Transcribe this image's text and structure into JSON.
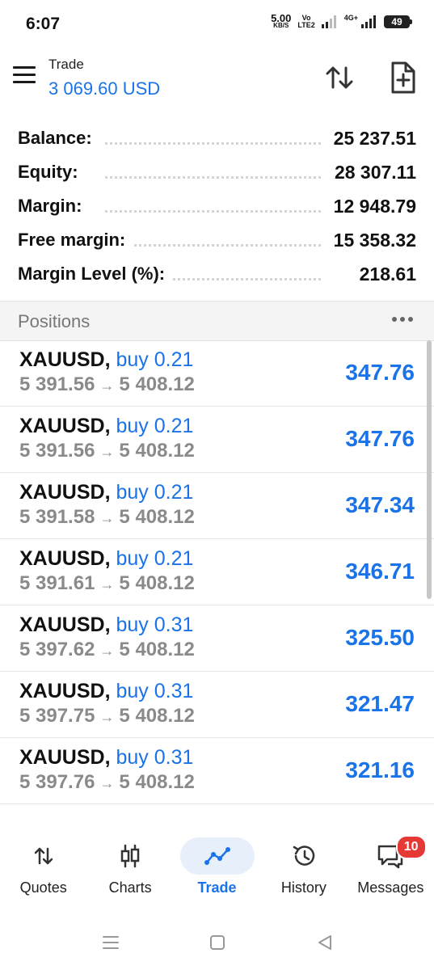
{
  "status_bar": {
    "time": "6:07",
    "net_speed_value": "5.00",
    "net_speed_unit": "KB/S",
    "volte_top": "Vo",
    "volte_bottom": "LTE2",
    "signal2_label": "4G+",
    "battery": "49"
  },
  "header": {
    "title": "Trade",
    "subtitle": "3 069.60 USD"
  },
  "summary": [
    {
      "label": "Balance:",
      "value": "25 237.51"
    },
    {
      "label": "Equity:",
      "value": "28 307.11"
    },
    {
      "label": "Margin:",
      "value": "12 948.79"
    },
    {
      "label": "Free margin:",
      "value": "15 358.32"
    },
    {
      "label": "Margin Level (%):",
      "value": "218.61"
    }
  ],
  "positions_title": "Positions",
  "positions": [
    {
      "symbol": "XAUUSD,",
      "side": "buy 0.21",
      "open": "5 391.56",
      "arrow": "→",
      "current": "5 408.12",
      "profit": "347.76"
    },
    {
      "symbol": "XAUUSD,",
      "side": "buy 0.21",
      "open": "5 391.56",
      "arrow": "→",
      "current": "5 408.12",
      "profit": "347.76"
    },
    {
      "symbol": "XAUUSD,",
      "side": "buy 0.21",
      "open": "5 391.58",
      "arrow": "→",
      "current": "5 408.12",
      "profit": "347.34"
    },
    {
      "symbol": "XAUUSD,",
      "side": "buy 0.21",
      "open": "5 391.61",
      "arrow": "→",
      "current": "5 408.12",
      "profit": "346.71"
    },
    {
      "symbol": "XAUUSD,",
      "side": "buy 0.31",
      "open": "5 397.62",
      "arrow": "→",
      "current": "5 408.12",
      "profit": "325.50"
    },
    {
      "symbol": "XAUUSD,",
      "side": "buy 0.31",
      "open": "5 397.75",
      "arrow": "→",
      "current": "5 408.12",
      "profit": "321.47"
    },
    {
      "symbol": "XAUUSD,",
      "side": "buy 0.31",
      "open": "5 397.76",
      "arrow": "→",
      "current": "5 408.12",
      "profit": "321.16"
    }
  ],
  "nav": [
    {
      "label": "Quotes",
      "icon": "quotes-icon"
    },
    {
      "label": "Charts",
      "icon": "charts-icon"
    },
    {
      "label": "Trade",
      "icon": "trade-icon",
      "active": true
    },
    {
      "label": "History",
      "icon": "history-icon"
    },
    {
      "label": "Messages",
      "icon": "messages-icon",
      "badge": "10"
    }
  ],
  "colors": {
    "accent": "#1a73e8",
    "badge": "#e53935",
    "muted_text": "#8a8a8a"
  }
}
